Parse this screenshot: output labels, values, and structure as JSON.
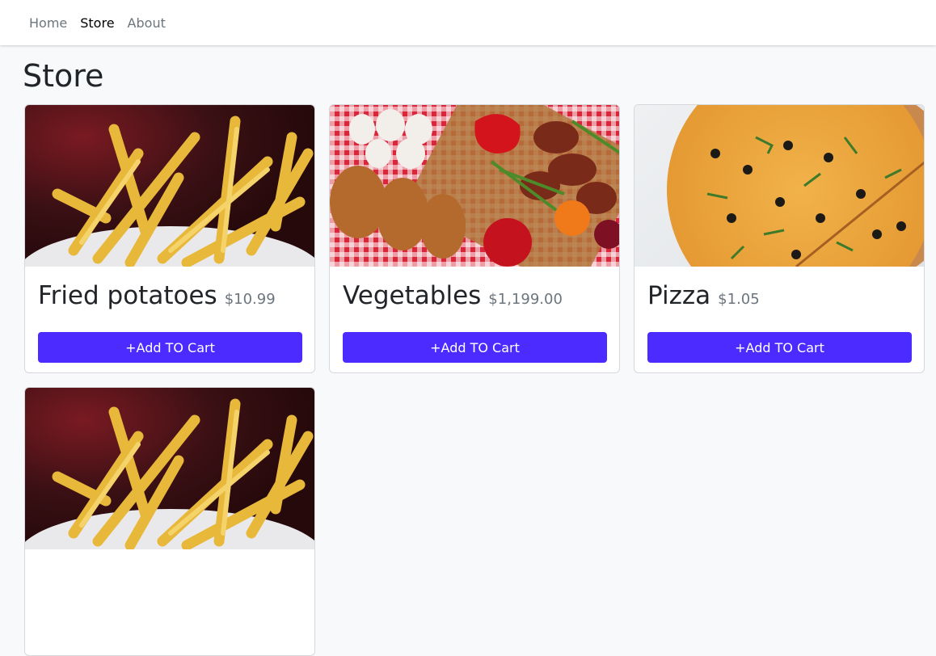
{
  "nav": {
    "items": [
      {
        "label": "Home",
        "active": false
      },
      {
        "label": "Store",
        "active": true
      },
      {
        "label": "About",
        "active": false
      }
    ]
  },
  "page": {
    "title": "Store"
  },
  "products": [
    {
      "name": "Fried potatoes",
      "price": "$10.99",
      "button": "+Add TO Cart",
      "image": "fries"
    },
    {
      "name": "Vegetables",
      "price": "$1,199.00",
      "button": "+Add TO Cart",
      "image": "vegetables"
    },
    {
      "name": "Pizza",
      "price": "$1.05",
      "button": "+Add TO Cart",
      "image": "pizza"
    },
    {
      "name": "",
      "price": "",
      "button": "",
      "image": "fries"
    }
  ],
  "colors": {
    "accent": "#4b2bff",
    "background": "#f8f9fa",
    "muted": "#6c757d"
  }
}
